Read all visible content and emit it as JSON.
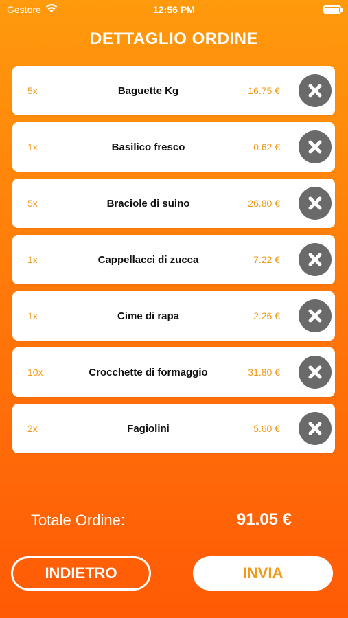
{
  "status_bar": {
    "carrier": "Gestore",
    "time": "12:56 PM"
  },
  "header": {
    "title": "DETTAGLIO ORDINE"
  },
  "order": {
    "items": [
      {
        "qty": "5x",
        "name": "Baguette Kg",
        "price": "16.75 €"
      },
      {
        "qty": "1x",
        "name": "Basilico fresco",
        "price": "0.62 €"
      },
      {
        "qty": "5x",
        "name": "Braciole di suino",
        "price": "26.80 €"
      },
      {
        "qty": "1x",
        "name": "Cappellacci di zucca",
        "price": "7.22 €"
      },
      {
        "qty": "1x",
        "name": "Cime di rapa",
        "price": "2.26 €"
      },
      {
        "qty": "10x",
        "name": "Crocchette di formaggio",
        "price": "31.80 €"
      },
      {
        "qty": "2x",
        "name": "Fagiolini",
        "price": "5.60 €"
      }
    ],
    "remove_icon": "close-x-icon"
  },
  "total": {
    "label": "Totale Ordine:",
    "value": "91.05 €"
  },
  "actions": {
    "back_label": "INDIETRO",
    "send_label": "INVIA"
  },
  "colors": {
    "accent": "#f29a18",
    "background_top": "#ff9a0c",
    "background_bottom": "#ff5a06",
    "remove_button": "#6a6a6a"
  }
}
